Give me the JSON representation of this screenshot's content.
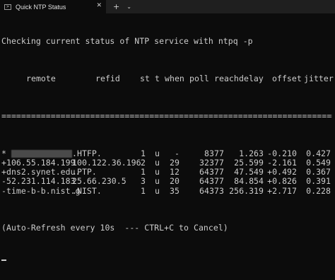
{
  "tab": {
    "title": "Quick NTP Status",
    "icon": "terminal-icon",
    "close": "✕",
    "new_tab": "+",
    "dropdown": "⌄"
  },
  "terminal": {
    "command_line": "Checking current status of NTP service with ntpq -p",
    "headers": {
      "remote": "remote",
      "refid": "refid",
      "st": "st",
      "t": "t",
      "when": "when",
      "poll": "poll",
      "reach": "reach",
      "delay": "delay",
      "offset": "offset",
      "jitter": "jitter"
    },
    "separator": "==============================================================================",
    "peers": [
      {
        "remote": "*",
        "refid": ".HTFP.",
        "st": "1",
        "t": "u",
        "when": "-",
        "poll": "8",
        "reach": "377",
        "delay": "1.263",
        "offset": "-0.210",
        "jitter": "0.427"
      },
      {
        "remote": "+106.55.184.199",
        "refid": "100.122.36.196",
        "st": "2",
        "t": "u",
        "when": "29",
        "poll": "32",
        "reach": "377",
        "delay": "25.599",
        "offset": "-2.161",
        "jitter": "0.549"
      },
      {
        "remote": "+dns2.synet.edu.",
        "refid": ".PTP.",
        "st": "1",
        "t": "u",
        "when": "12",
        "poll": "64",
        "reach": "377",
        "delay": "47.549",
        "offset": "+0.492",
        "jitter": "0.367"
      },
      {
        "remote": "-52.231.114.183",
        "refid": "25.66.230.5",
        "st": "3",
        "t": "u",
        "when": "20",
        "poll": "64",
        "reach": "377",
        "delay": "84.854",
        "offset": "+0.826",
        "jitter": "0.391"
      },
      {
        "remote": "-time-b-b.nist.g",
        "refid": ".NIST.",
        "st": "1",
        "t": "u",
        "when": "35",
        "poll": "64",
        "reach": "373",
        "delay": "256.319",
        "offset": "+2.717",
        "jitter": "0.228"
      }
    ],
    "footer": "(Auto-Refresh every 10s  --- CTRL+C to Cancel)"
  }
}
